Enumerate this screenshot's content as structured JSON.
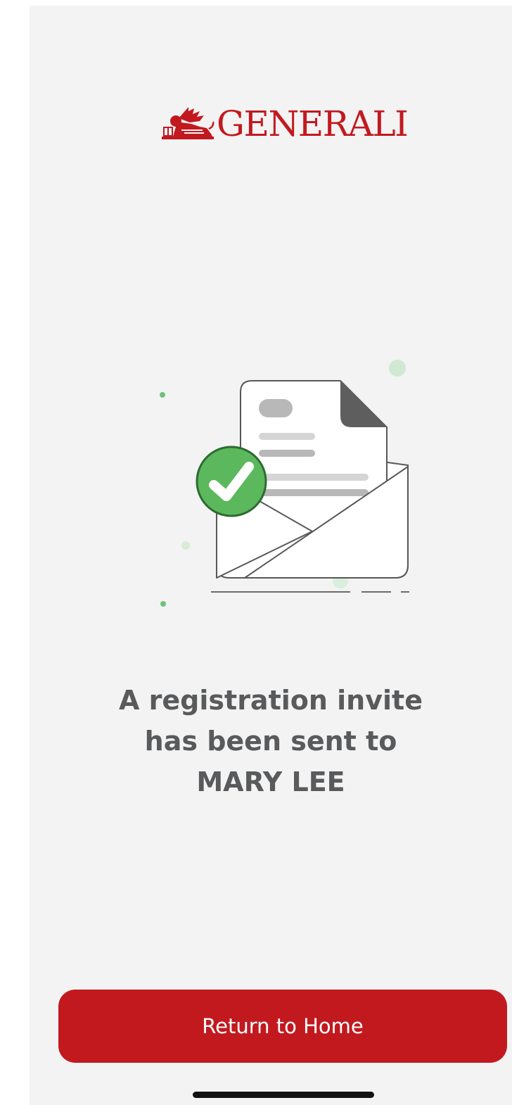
{
  "brand": {
    "name": "GENERALI",
    "color": "#c2191f"
  },
  "illustration": {
    "icon": "envelope-with-document-check-icon",
    "check_color": "#5cb85c"
  },
  "message": {
    "line1": "A registration invite",
    "line2": "has been sent to",
    "recipient": "MARY LEE"
  },
  "actions": {
    "return_home_label": "Return to Home"
  }
}
